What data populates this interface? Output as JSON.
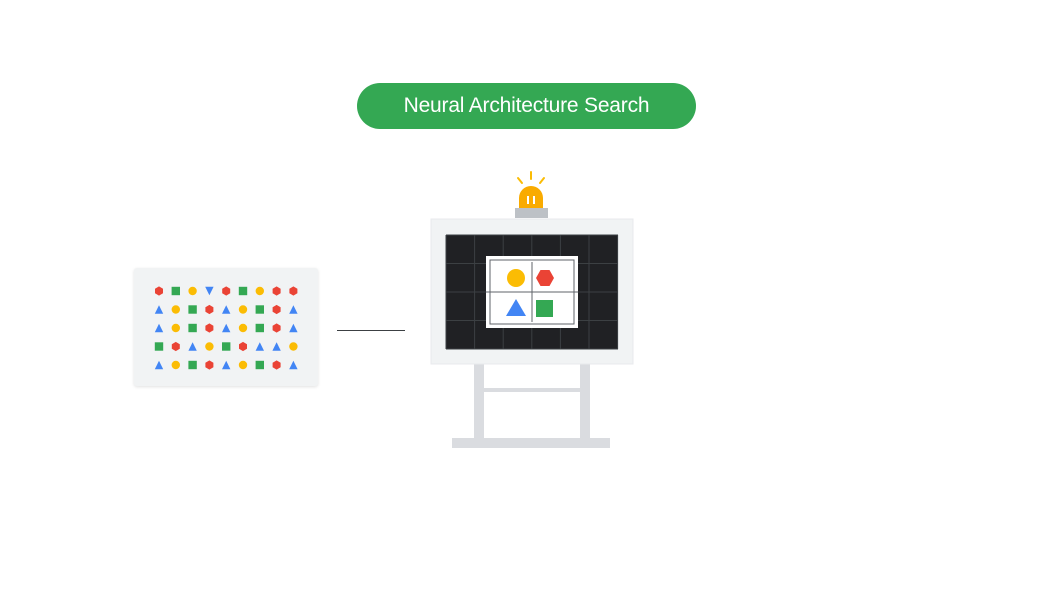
{
  "title": "Neural Architecture Search",
  "colors": {
    "green": "#34a853",
    "red": "#ea4335",
    "yellow": "#fbbc04",
    "blue": "#4285f4",
    "board_frame": "#e8eaed",
    "board_screen": "#202124",
    "easel": "#bdc1c6"
  },
  "dataset_grid": [
    [
      "hexagon-red",
      "square-green",
      "circle-yellow",
      "triangle-down-blue",
      "hexagon-red",
      "square-green",
      "circle-yellow",
      "hexagon-red",
      "hexagon-red"
    ],
    [
      "triangle-blue",
      "circle-yellow",
      "square-green",
      "hexagon-red",
      "triangle-blue",
      "circle-yellow",
      "square-green",
      "hexagon-red",
      "triangle-blue"
    ],
    [
      "triangle-blue",
      "circle-yellow",
      "square-green",
      "hexagon-red",
      "triangle-blue",
      "circle-yellow",
      "square-green",
      "hexagon-red",
      "triangle-blue"
    ],
    [
      "square-green",
      "hexagon-red",
      "triangle-blue",
      "circle-yellow",
      "square-green",
      "hexagon-red",
      "triangle-blue",
      "triangle-blue",
      "circle-yellow"
    ],
    [
      "triangle-blue",
      "circle-yellow",
      "square-green",
      "hexagon-red",
      "triangle-blue",
      "circle-yellow",
      "square-green",
      "hexagon-red",
      "triangle-blue"
    ]
  ],
  "board_shapes": [
    "circle-yellow",
    "hexagon-red",
    "triangle-blue",
    "square-green"
  ],
  "icons": {
    "alarm": "alarm-light-icon",
    "easel": "easel-board-icon"
  }
}
